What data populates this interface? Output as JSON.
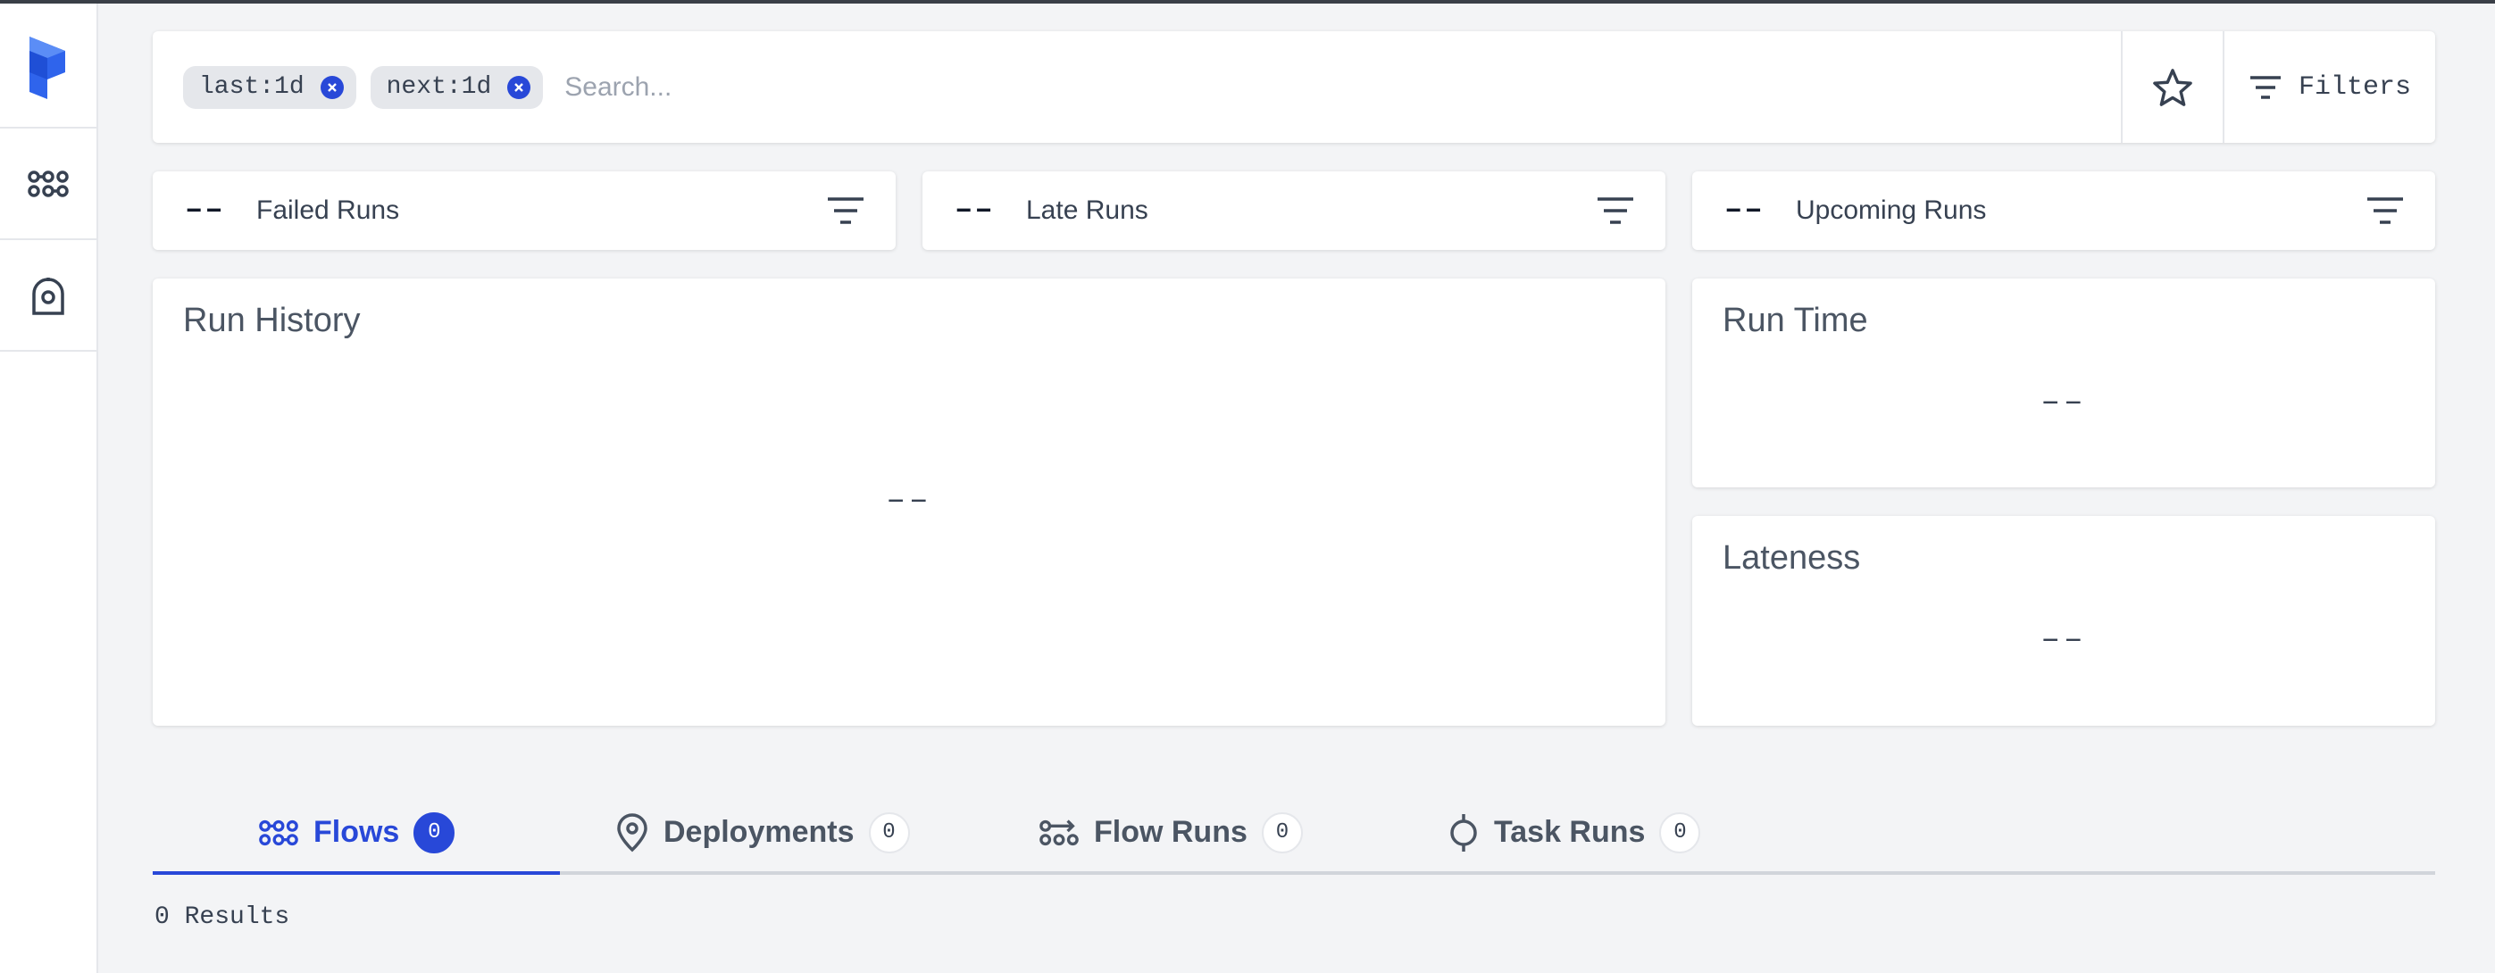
{
  "search": {
    "tags": [
      "last:1d",
      "next:1d"
    ],
    "placeholder": "Search..."
  },
  "toolbar": {
    "filters_label": "Filters"
  },
  "stats": [
    {
      "label": "Failed Runs",
      "value": "––"
    },
    {
      "label": "Late Runs",
      "value": "––"
    },
    {
      "label": "Upcoming Runs",
      "value": "––"
    }
  ],
  "panels": {
    "run_history": {
      "title": "Run History",
      "value": "––"
    },
    "run_time": {
      "title": "Run Time",
      "value": "––"
    },
    "lateness": {
      "title": "Lateness",
      "value": "––"
    }
  },
  "tabs": [
    {
      "label": "Flows",
      "count": "0",
      "active": true
    },
    {
      "label": "Deployments",
      "count": "0",
      "active": false
    },
    {
      "label": "Flow Runs",
      "count": "0",
      "active": false
    },
    {
      "label": "Task Runs",
      "count": "0",
      "active": false
    }
  ],
  "results": {
    "text": "0 Results"
  },
  "colors": {
    "accent": "#2848d8",
    "logo": "#3b6ff0"
  }
}
